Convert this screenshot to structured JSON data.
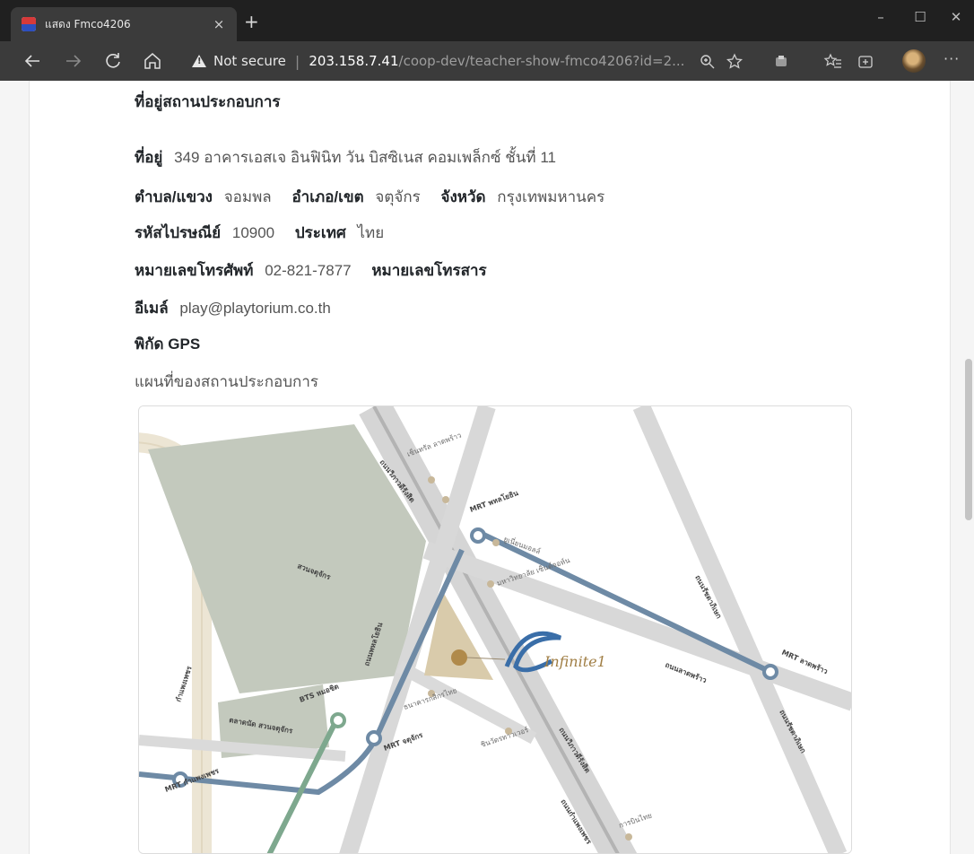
{
  "browser": {
    "tab_title": "แสดง Fmco4206",
    "tab_close": "×",
    "new_tab": "+",
    "window_minimize": "–",
    "window_maximize": "☐",
    "window_close": "✕",
    "security_label": "Not secure",
    "url_host": "203.158.7.41",
    "url_path": "/coop-dev/teacher-show-fmco4206?id=2...",
    "more_label": "···"
  },
  "page": {
    "section_title": "ที่อยู่สถานประกอบการ",
    "address_label": "ที่อยู่",
    "address_value": "349 อาคารเอสเจ อินฟินิท วัน บิสซิเนส คอมเพล็กซ์ ชั้นที่ 11",
    "subdistrict_label": "ตำบล/แขวง",
    "subdistrict_value": "จอมพล",
    "district_label": "อำเภอ/เขต",
    "district_value": "จตุจักร",
    "province_label": "จังหวัด",
    "province_value": "กรุงเทพมหานคร",
    "postcode_label": "รหัสไปรษณีย์",
    "postcode_value": "10900",
    "country_label": "ประเทศ",
    "country_value": "ไทย",
    "phone_label": "หมายเลขโทรศัพท์",
    "phone_value": "02-821-7877",
    "fax_label": "หมายเลขโทรสาร",
    "email_label": "อีเมล์",
    "email_value": "play@playtorium.co.th",
    "gps_label": "พิกัด GPS",
    "map_caption": "แผนที่ของสถานประกอบการ"
  },
  "map": {
    "brand": "Infinite1",
    "labels": {
      "road_vibhavadi": "ถนนวิภาวดีรังสิต",
      "road_phahonyothin": "ถนนพหลโยธิน",
      "road_ratchadaphisek": "ถนนรัชดาภิเษก",
      "road_lat_phrao": "ถนนลาดพร้าว",
      "road_kamphaeng_phet": "กำแพงเพชร",
      "road_kampaeng_srisuk": "ถนนกำแพงเพชร",
      "park_chatuchak": "สวนจตุจักร",
      "market_chatuchak": "ตลาดนัด สวนจตุจักร",
      "mrt_phahon": "MRT พหลโยธิน",
      "mrt_lat_phrao": "MRT ลาดพร้าว",
      "mrt_chatuchak": "MRT จตุจักร",
      "mrt_kamphaeng": "MRT กำแพงเพชร",
      "bts_mochit": "BTS หมอชิต",
      "poi_central": "เซ็นทรัล ลาดพร้าว",
      "poi_union": "ยูเนี่ยนมอลล์",
      "poi_university": "มหาวิทยาลัย เซ็นต์จอห์น",
      "poi_bank": "ธนาคารกสิกรไทย",
      "poi_tower": "ชินวัตรทาวเวอร์",
      "poi_thai": "การบินไทย"
    }
  }
}
